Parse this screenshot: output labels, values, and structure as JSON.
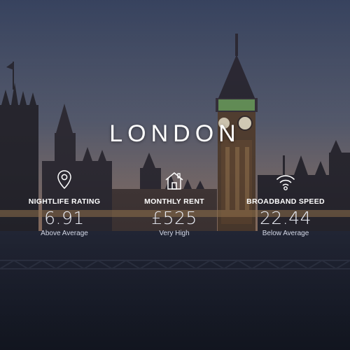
{
  "city": {
    "name": "LONDON"
  },
  "stats": [
    {
      "label": "NIGHTLIFE RATING",
      "value": "6.91",
      "note": "Above Average",
      "icon": "map-pin-icon"
    },
    {
      "label": "MONTHLY RENT",
      "value": "£525",
      "note": "Very High",
      "icon": "house-icon"
    },
    {
      "label": "BROADBAND SPEED",
      "value": "22.44",
      "note": "Below Average",
      "icon": "wifi-icon"
    }
  ],
  "colors": {
    "sky_top": "#3e4a68",
    "sky_mid": "#6a6a7e",
    "sky_horizon": "#a6806a",
    "text": "#ffffff",
    "clock_green": "#7fbf6a"
  }
}
